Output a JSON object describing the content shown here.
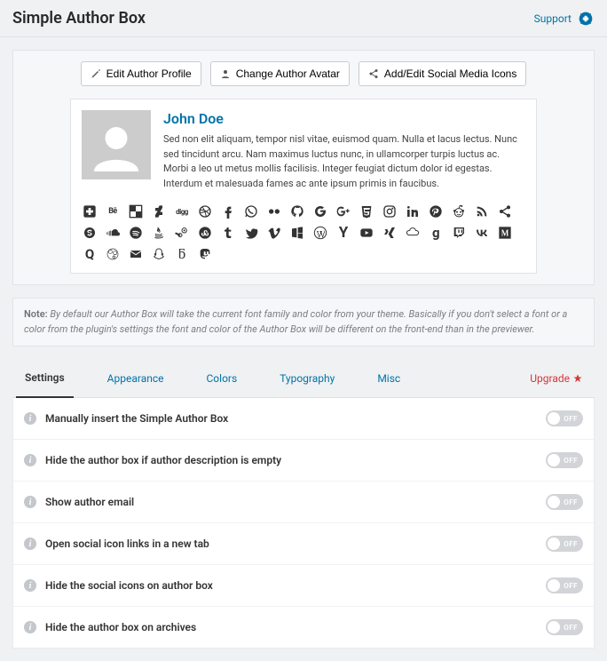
{
  "header": {
    "title": "Simple Author Box",
    "support_label": "Support"
  },
  "toolbar": {
    "edit_profile": "Edit Author Profile",
    "change_avatar": "Change Author Avatar",
    "add_social": "Add/Edit Social Media Icons"
  },
  "author": {
    "name": "John Doe",
    "description": "Sed non elit aliquam, tempor nisl vitae, euismod quam. Nulla et lacus lectus. Nunc sed tincidunt arcu. Nam maximus luctus nunc, in ullamcorper turpis luctus ac. Morbi a leo ut metus mollis facilisis. Integer feugiat dictum dolor id egestas. Interdum et malesuada fames ac ante ipsum primis in faucibus."
  },
  "social_icons": [
    "addthis",
    "behance",
    "delicious",
    "deviantart",
    "digg",
    "dribbble",
    "facebook",
    "whatsapp",
    "flickr",
    "github",
    "google",
    "googleplus",
    "html5",
    "instagram",
    "linkedin",
    "pinterest",
    "reddit",
    "rss",
    "share",
    "skype",
    "soundcloud",
    "spotify",
    "java",
    "steam",
    "stumbleupon",
    "tumblr",
    "twitter",
    "vimeo",
    "windows",
    "wordpress",
    "y",
    "youtube",
    "xing",
    "mixcloud",
    "goodreads",
    "twitch",
    "vk",
    "medium",
    "quora",
    "meetup",
    "mail",
    "snapchat",
    "500px",
    "mastodon"
  ],
  "note": {
    "label": "Note:",
    "text": "By default our Author Box will take the current font family and color from your theme. Basically if you don't select a font or a color from the plugin's settings the font and color of the Author Box will be different on the front-end than in the previewer."
  },
  "tabs": {
    "items": [
      "Settings",
      "Appearance",
      "Colors",
      "Typography",
      "Misc"
    ],
    "upgrade": "Upgrade"
  },
  "settings": {
    "toggle_state_label": "OFF",
    "rows": [
      {
        "label": "Manually insert the Simple Author Box",
        "state": "off"
      },
      {
        "label": "Hide the author box if author description is empty",
        "state": "off"
      },
      {
        "label": "Show author email",
        "state": "off"
      },
      {
        "label": "Open social icon links in a new tab",
        "state": "off"
      },
      {
        "label": "Hide the social icons on author box",
        "state": "off"
      },
      {
        "label": "Hide the author box on archives",
        "state": "off"
      }
    ]
  }
}
